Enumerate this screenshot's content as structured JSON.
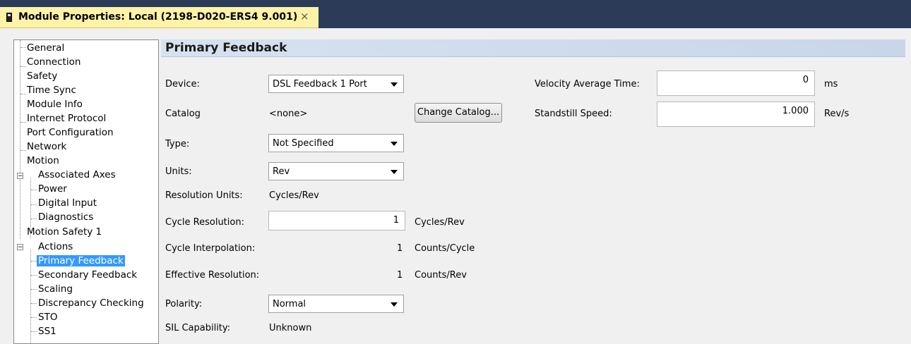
{
  "window": {
    "title": "Module Properties: Local (2198-D020-ERS4 9.001)",
    "close_glyph": "×",
    "icon": "module-icon"
  },
  "tree": {
    "items": [
      {
        "label": "General"
      },
      {
        "label": "Connection"
      },
      {
        "label": "Safety"
      },
      {
        "label": "Time Sync"
      },
      {
        "label": "Module Info"
      },
      {
        "label": "Internet Protocol"
      },
      {
        "label": "Port Configuration"
      },
      {
        "label": "Network"
      },
      {
        "label": "Motion",
        "expander": "−"
      },
      {
        "label": "Associated Axes"
      },
      {
        "label": "Power"
      },
      {
        "label": "Digital Input"
      },
      {
        "label": "Diagnostics"
      },
      {
        "label": "Motion Safety 1",
        "expander": "−"
      },
      {
        "label": "Actions"
      },
      {
        "label": "Primary Feedback"
      },
      {
        "label": "Secondary Feedback"
      },
      {
        "label": "Scaling"
      },
      {
        "label": "Discrepancy Checking"
      },
      {
        "label": "STO"
      },
      {
        "label": "SS1"
      }
    ],
    "selected": "Primary Feedback"
  },
  "section": {
    "title": "Primary Feedback"
  },
  "form": {
    "device": {
      "label": "Device:",
      "value": "DSL Feedback 1 Port"
    },
    "catalog": {
      "label": "Catalog",
      "value": "<none>",
      "button": "Change Catalog..."
    },
    "type": {
      "label": "Type:",
      "value": "Not Specified"
    },
    "units": {
      "label": "Units:",
      "value": "Rev"
    },
    "resolution_units": {
      "label": "Resolution Units:",
      "value": "Cycles/Rev"
    },
    "cycle_resolution": {
      "label": "Cycle Resolution:",
      "value": "1",
      "unit": "Cycles/Rev"
    },
    "cycle_interpolation": {
      "label": "Cycle Interpolation:",
      "value": "1",
      "unit": "Counts/Cycle"
    },
    "effective_resolution": {
      "label": "Effective Resolution:",
      "value": "1",
      "unit": "Counts/Rev"
    },
    "polarity": {
      "label": "Polarity:",
      "value": "Normal"
    },
    "sil_capability": {
      "label": "SIL Capability:",
      "value": "Unknown"
    },
    "velocity_average_time": {
      "label": "Velocity Average Time:",
      "value": "0",
      "unit": "ms"
    },
    "standstill_speed": {
      "label": "Standstill Speed:",
      "value": "1.000",
      "unit": "Rev/s"
    }
  },
  "colors": {
    "titlebar": "#2b3b58",
    "tab": "#fff3a8",
    "selection": "#3399ff",
    "section_header": "#c7d6ea"
  }
}
